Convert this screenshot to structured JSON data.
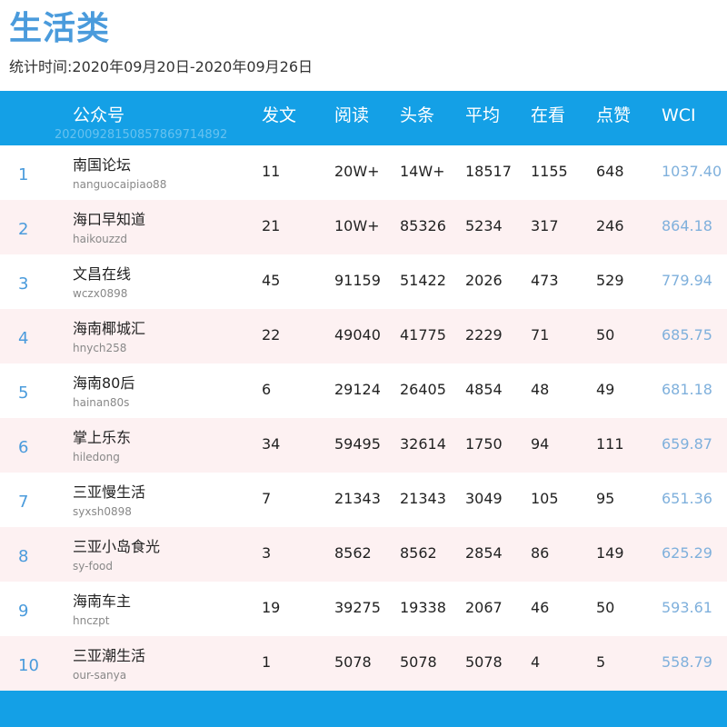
{
  "title": "生活类",
  "subtitle": "统计时间:2020年09月20日-2020年09月26日",
  "header": {
    "account": "公众号",
    "watermark": "20200928150857869714892",
    "posts": "发文",
    "reads": "阅读",
    "headline": "头条",
    "average": "平均",
    "watching": "在看",
    "likes": "点赞",
    "wci": "WCI"
  },
  "colors": {
    "header_bg": "#14a0e6",
    "title": "#4a9bdc",
    "alt_row": "#fdf1f2",
    "wci": "#7fb0dc"
  },
  "rows": [
    {
      "rank": "1",
      "name": "南国论坛",
      "account": "nanguocaipiao88",
      "posts": "11",
      "reads": "20W+",
      "headline": "14W+",
      "average": "18517",
      "watching": "1155",
      "likes": "648",
      "wci": "1037.40"
    },
    {
      "rank": "2",
      "name": "海口早知道",
      "account": "haikouzzd",
      "posts": "21",
      "reads": "10W+",
      "headline": "85326",
      "average": "5234",
      "watching": "317",
      "likes": "246",
      "wci": "864.18"
    },
    {
      "rank": "3",
      "name": "文昌在线",
      "account": "wczx0898",
      "posts": "45",
      "reads": "91159",
      "headline": "51422",
      "average": "2026",
      "watching": "473",
      "likes": "529",
      "wci": "779.94"
    },
    {
      "rank": "4",
      "name": "海南椰城汇",
      "account": "hnych258",
      "posts": "22",
      "reads": "49040",
      "headline": "41775",
      "average": "2229",
      "watching": "71",
      "likes": "50",
      "wci": "685.75"
    },
    {
      "rank": "5",
      "name": "海南80后",
      "account": "hainan80s",
      "posts": "6",
      "reads": "29124",
      "headline": "26405",
      "average": "4854",
      "watching": "48",
      "likes": "49",
      "wci": "681.18"
    },
    {
      "rank": "6",
      "name": "掌上乐东",
      "account": "hiledong",
      "posts": "34",
      "reads": "59495",
      "headline": "32614",
      "average": "1750",
      "watching": "94",
      "likes": "111",
      "wci": "659.87"
    },
    {
      "rank": "7",
      "name": "三亚慢生活",
      "account": "syxsh0898",
      "posts": "7",
      "reads": "21343",
      "headline": "21343",
      "average": "3049",
      "watching": "105",
      "likes": "95",
      "wci": "651.36"
    },
    {
      "rank": "8",
      "name": "三亚小岛食光",
      "account": "sy-food",
      "posts": "3",
      "reads": "8562",
      "headline": "8562",
      "average": "2854",
      "watching": "86",
      "likes": "149",
      "wci": "625.29"
    },
    {
      "rank": "9",
      "name": "海南车主",
      "account": "hnczpt",
      "posts": "19",
      "reads": "39275",
      "headline": "19338",
      "average": "2067",
      "watching": "46",
      "likes": "50",
      "wci": "593.61"
    },
    {
      "rank": "10",
      "name": "三亚潮生活",
      "account": "our-sanya",
      "posts": "1",
      "reads": "5078",
      "headline": "5078",
      "average": "5078",
      "watching": "4",
      "likes": "5",
      "wci": "558.79"
    }
  ]
}
